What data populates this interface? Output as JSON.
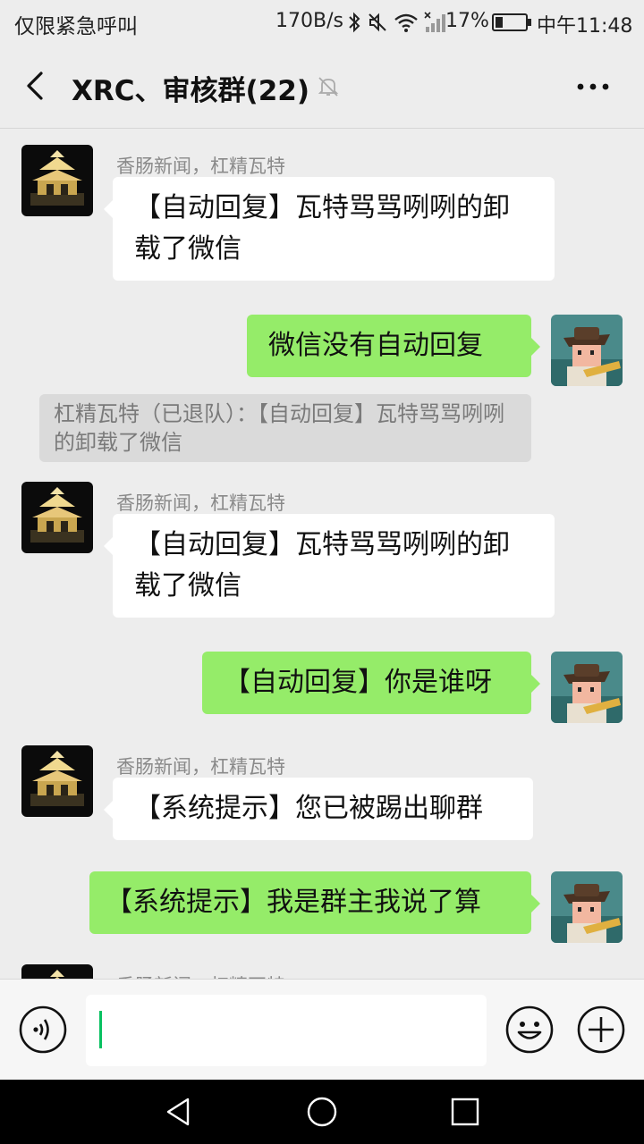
{
  "status_bar": {
    "carrier_text": "仅限紧急呼叫",
    "net_speed": "170B/s",
    "battery_percent": "17%",
    "time": "中午11:48",
    "icons": [
      "bluetooth-icon",
      "mute-icon",
      "wifi-icon",
      "signal-icon",
      "battery-icon"
    ]
  },
  "header": {
    "title": "XRC、审核群(22)",
    "icons": [
      "back-arrow-icon",
      "mute-bell-icon",
      "more-icon"
    ]
  },
  "messages": [
    {
      "side": "left",
      "sender": "香肠新闻，杠精瓦特",
      "text": "【自动回复】瓦特骂骂咧咧的卸载了微信"
    },
    {
      "side": "right",
      "text": "微信没有自动回复"
    },
    {
      "type": "system",
      "text": "杠精瓦特（已退队）：【自动回复】瓦特骂骂咧咧的卸载了微信"
    },
    {
      "side": "left",
      "sender": "香肠新闻，杠精瓦特",
      "text": "【自动回复】瓦特骂骂咧咧的卸载了微信"
    },
    {
      "side": "right",
      "text": "【自动回复】你是谁呀"
    },
    {
      "side": "left",
      "sender": "香肠新闻，杠精瓦特",
      "text": "【系统提示】您已被踢出聊群"
    },
    {
      "side": "right",
      "text": "【系统提示】我是群主我说了算"
    },
    {
      "side": "left",
      "sender": "香肠新闻，杠精瓦特",
      "text": ""
    }
  ],
  "input_bar": {
    "value": "",
    "icons": [
      "voice-icon",
      "emoji-icon",
      "plus-icon"
    ]
  },
  "nav_bar": {
    "icons": [
      "nav-back-icon",
      "nav-home-icon",
      "nav-recents-icon"
    ]
  },
  "colors": {
    "background": "#ededed",
    "sent_bubble": "#95ec69",
    "received_bubble": "#ffffff",
    "accent": "#07c160"
  }
}
